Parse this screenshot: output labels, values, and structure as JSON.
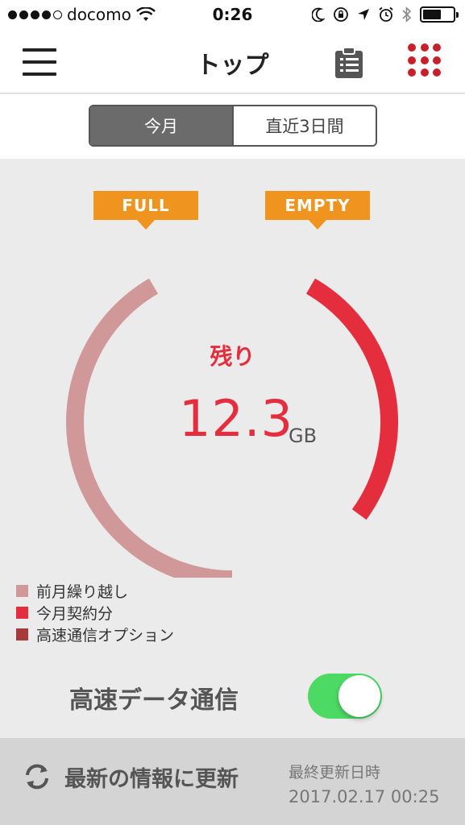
{
  "status_bar": {
    "carrier": "docomo",
    "time": "0:26",
    "battery_level": 0.62,
    "icons": [
      "signal-dots-icon",
      "wifi-icon",
      "moon-icon",
      "rotation-lock-icon",
      "location-icon",
      "alarm-icon",
      "bluetooth-icon",
      "battery-icon"
    ]
  },
  "nav": {
    "title": "トップ",
    "left_icon": "hamburger-menu-icon",
    "right_icons": [
      "clipboard-list-icon",
      "app-grid-icon"
    ]
  },
  "period_tabs": [
    {
      "label": "今月",
      "selected": true
    },
    {
      "label": "直近3日間",
      "selected": false
    }
  ],
  "gauge": {
    "full_tag": "FULL",
    "empty_tag": "EMPTY",
    "remaining_label": "残り",
    "remaining_value": "12.3",
    "remaining_unit": "GB",
    "segments": [
      {
        "name": "前月繰り越し",
        "color": "#d09898",
        "fraction": 0.5
      },
      {
        "name": "今月契約分",
        "color": "#e52e3d",
        "fraction": 0.32
      }
    ]
  },
  "legend": [
    {
      "label": "前月繰り越し",
      "color": "#d09898"
    },
    {
      "label": "今月契約分",
      "color": "#e52e3d"
    },
    {
      "label": "高速通信オプション",
      "color": "#a83a3a"
    }
  ],
  "high_speed": {
    "label": "高速データ通信",
    "enabled": true,
    "on_color": "#4cd964"
  },
  "refresh": {
    "label": "最新の情報に更新",
    "icon": "refresh-icon",
    "updated_label": "最終更新日時",
    "updated_value": "2017.02.17 00:25"
  },
  "colors": {
    "accent_red": "#e52e3d",
    "tag_orange": "#ef951f",
    "menu_grid_red": "#c8202a"
  }
}
